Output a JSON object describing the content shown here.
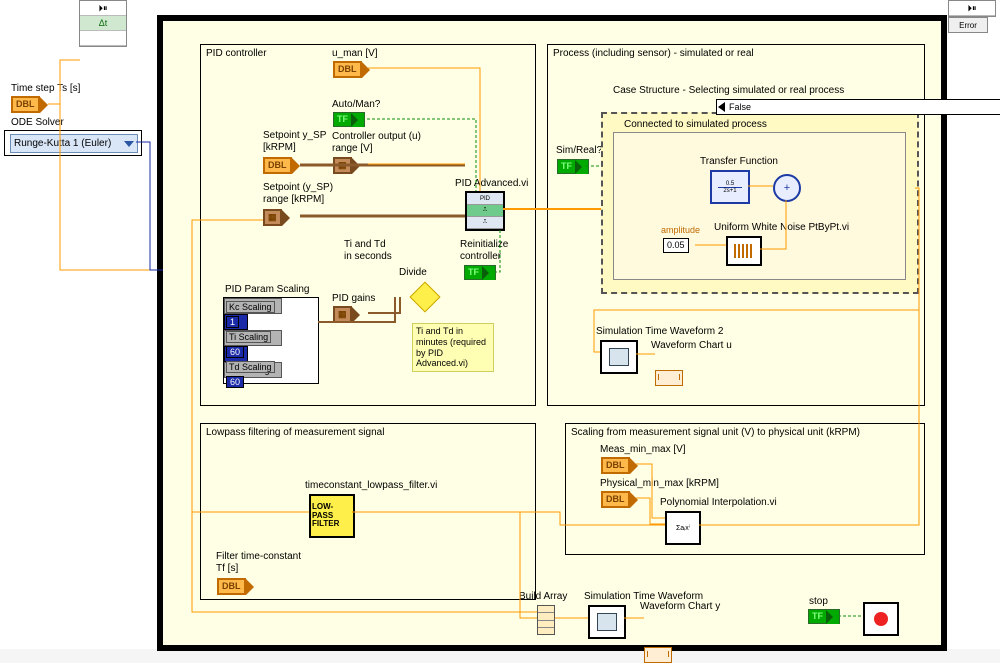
{
  "header_left": {
    "tool": "⏵⏸⏹"
  },
  "header_right": {
    "tool": "⏵⏸⏹",
    "error_label": "Error"
  },
  "controls": {
    "time_step_label": "Time step Ts [s]",
    "dbl": "DBL",
    "ode_solver_label": "ODE Solver",
    "ode_solver_value": "Runge-Kutta 1 (Euler)",
    "dt_symbol": "Δt"
  },
  "pid": {
    "title": "PID controller",
    "u_man": "u_man [V]",
    "auto_man": "Auto/Man?",
    "controller_output": "Controller output (u)\nrange [V]",
    "setpoint": "Setpoint y_SP\n[kRPM]",
    "setpoint_range": "Setpoint (y_SP)\nrange [kRPM]",
    "pid_advanced": "PID Advanced.vi",
    "ti_td_sec": "Ti and Td\nin seconds",
    "divide": "Divide",
    "reinit": "Reinitialize\ncontroller",
    "tip": "Ti and Td\nin minutes\n(required by\nPID Advanced.vi)",
    "pid_gains": "PID gains",
    "param_title": "PID Param Scaling",
    "kc_label": "Kc Scaling",
    "kc_val": "1",
    "ti_label": "Ti Scaling",
    "ti_val": "60",
    "td_label": "Td Scaling",
    "td_val": "60"
  },
  "process": {
    "title": "Process (including sensor) - simulated or real",
    "simreal": "Sim/Real?",
    "case_title": "Case Structure - Selecting simulated or real process",
    "case_value": "False",
    "connected": "Connected to simulated process",
    "transfer_fn": "Transfer Function",
    "xfer_num": "0.5",
    "xfer_den": "2s+1",
    "amplitude_label": "amplitude",
    "amplitude_val": "0.05",
    "noise": "Uniform White Noise PtByPt.vi",
    "sim_waveform2": "Simulation Time Waveform 2",
    "waveform_u": "Waveform Chart u"
  },
  "scaling": {
    "title": "Scaling from measurement signal unit (V) to physical unit (kRPM)",
    "meas": "Meas_min_max [V]",
    "phys": "Physical_min_max [kRPM]",
    "poly": "Polynomial Interpolation.vi",
    "poly_sym": "Σaᵢxⁱ"
  },
  "lowpass": {
    "title": "Lowpass filtering of measurement signal",
    "vi": "timeconstant_lowpass_filter.vi",
    "lp1": "LOW-",
    "lp2": "PASS",
    "lp3": "FILTER",
    "tc": "Filter time-constant\nTf [s]"
  },
  "bottom": {
    "build": "Build Array",
    "sim_waveform": "Simulation Time Waveform",
    "waveform_y": "Waveform Chart y",
    "stop": "stop"
  },
  "tf_label": "TF"
}
